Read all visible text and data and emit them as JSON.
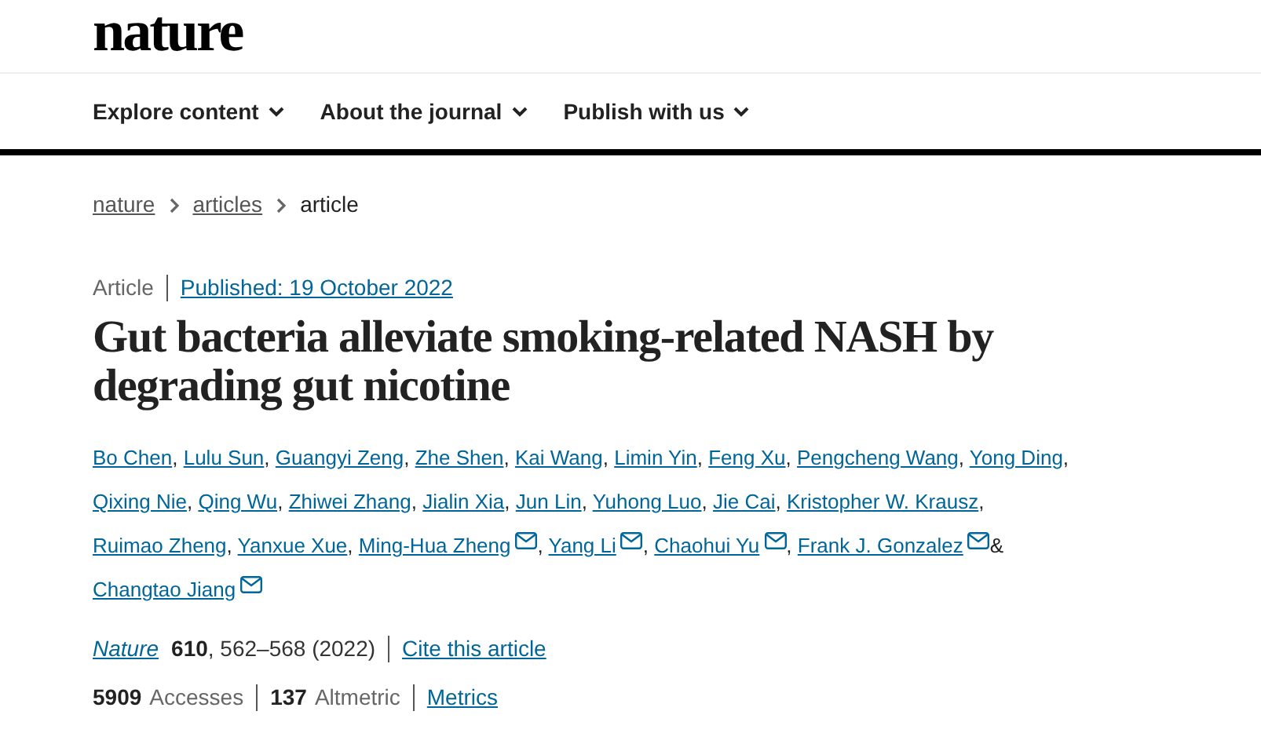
{
  "logo": "nature",
  "nav": [
    {
      "label": "Explore content"
    },
    {
      "label": "About the journal"
    },
    {
      "label": "Publish with us"
    }
  ],
  "breadcrumbs": [
    {
      "label": "nature",
      "link": true
    },
    {
      "label": "articles",
      "link": true
    },
    {
      "label": "article",
      "link": false
    }
  ],
  "article_type": "Article",
  "published": "Published: 19 October 2022",
  "title": "Gut bacteria alleviate smoking-related NASH by degrading gut nicotine",
  "authors": [
    {
      "name": "Bo Chen",
      "contact": false,
      "after": ","
    },
    {
      "name": "Lulu Sun",
      "contact": false,
      "after": ","
    },
    {
      "name": "Guangyi Zeng",
      "contact": false,
      "after": ","
    },
    {
      "name": "Zhe Shen",
      "contact": false,
      "after": ","
    },
    {
      "name": "Kai Wang",
      "contact": false,
      "after": ","
    },
    {
      "name": "Limin Yin",
      "contact": false,
      "after": ","
    },
    {
      "name": "Feng Xu",
      "contact": false,
      "after": ","
    },
    {
      "name": "Pengcheng Wang",
      "contact": false,
      "after": ","
    },
    {
      "name": "Yong Ding",
      "contact": false,
      "after": ","
    },
    {
      "name": "Qixing Nie",
      "contact": false,
      "after": ","
    },
    {
      "name": "Qing Wu",
      "contact": false,
      "after": ","
    },
    {
      "name": "Zhiwei Zhang",
      "contact": false,
      "after": ","
    },
    {
      "name": "Jialin Xia",
      "contact": false,
      "after": ","
    },
    {
      "name": "Jun Lin",
      "contact": false,
      "after": ","
    },
    {
      "name": "Yuhong Luo",
      "contact": false,
      "after": ","
    },
    {
      "name": "Jie Cai",
      "contact": false,
      "after": ","
    },
    {
      "name": "Kristopher W. Krausz",
      "contact": false,
      "after": ","
    },
    {
      "name": "Ruimao Zheng",
      "contact": false,
      "after": ","
    },
    {
      "name": "Yanxue Xue",
      "contact": false,
      "after": ","
    },
    {
      "name": "Ming-Hua Zheng",
      "contact": true,
      "after": ","
    },
    {
      "name": "Yang Li",
      "contact": true,
      "after": ","
    },
    {
      "name": "Chaohui Yu",
      "contact": true,
      "after": ","
    },
    {
      "name": "Frank J. Gonzalez",
      "contact": true,
      "after": "&"
    },
    {
      "name": "Changtao Jiang",
      "contact": true
    }
  ],
  "citation": {
    "journal": "Nature",
    "volume": "610",
    "pages": ", 562–568 (2022)",
    "cite_link": "Cite this article"
  },
  "metrics": [
    {
      "count": "5909",
      "unit": "Accesses"
    },
    {
      "count": "137",
      "unit": "Altmetric"
    }
  ],
  "metrics_link": "Metrics"
}
